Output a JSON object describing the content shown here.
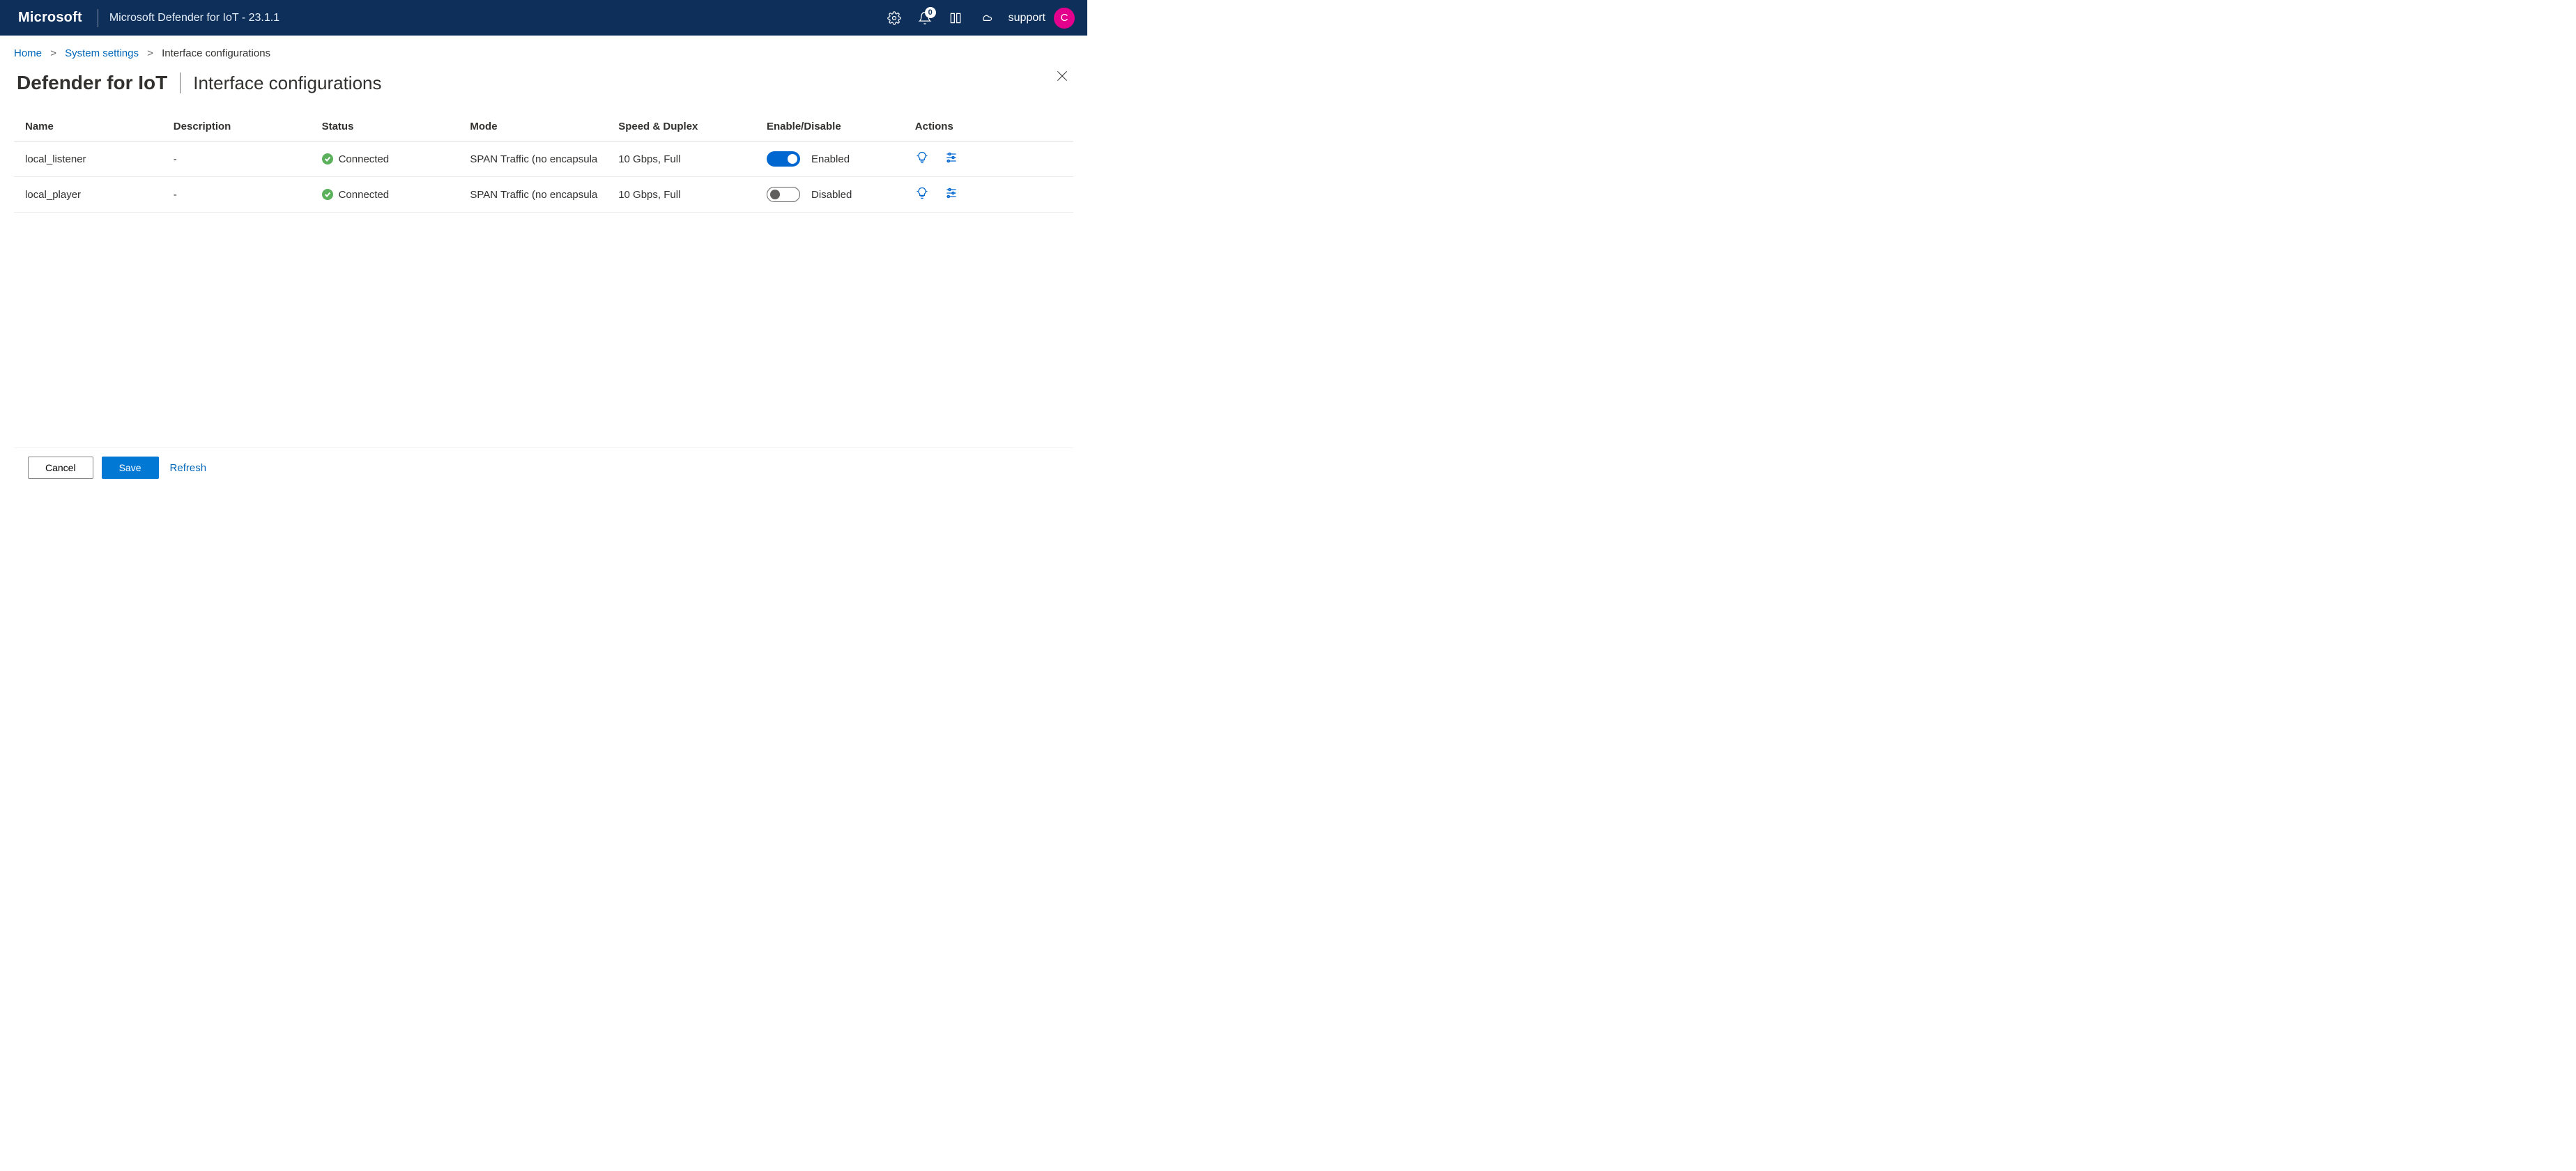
{
  "header": {
    "brand": "Microsoft",
    "app_title": "Microsoft Defender for IoT - 23.1.1",
    "notification_count": "0",
    "user_label": "support",
    "avatar_initial": "C"
  },
  "breadcrumb": {
    "home": "Home",
    "system_settings": "System settings",
    "current": "Interface configurations"
  },
  "page": {
    "title": "Defender for IoT",
    "subtitle": "Interface configurations"
  },
  "table": {
    "headers": {
      "name": "Name",
      "description": "Description",
      "status": "Status",
      "mode": "Mode",
      "speed": "Speed & Duplex",
      "enable": "Enable/Disable",
      "actions": "Actions"
    },
    "rows": [
      {
        "name": "local_listener",
        "description": "-",
        "status": "Connected",
        "mode": "SPAN Traffic (no encapsula",
        "speed": "10 Gbps, Full",
        "enabled": true,
        "enable_label": "Enabled"
      },
      {
        "name": "local_player",
        "description": "-",
        "status": "Connected",
        "mode": "SPAN Traffic (no encapsula",
        "speed": "10 Gbps, Full",
        "enabled": false,
        "enable_label": "Disabled"
      }
    ]
  },
  "footer": {
    "cancel": "Cancel",
    "save": "Save",
    "refresh": "Refresh"
  }
}
